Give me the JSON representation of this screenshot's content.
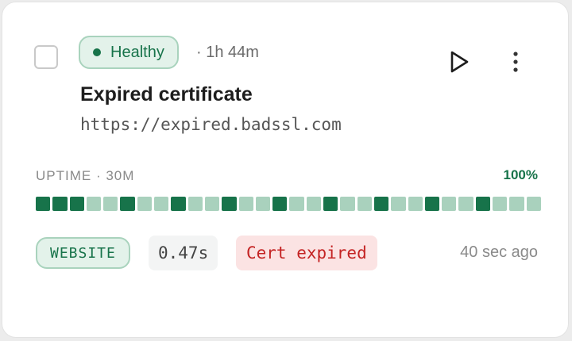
{
  "monitor": {
    "status_label": "Healthy",
    "status_color": "#17734a",
    "duration": "· 1h 44m",
    "title": "Expired certificate",
    "url": "https://expired.badssl.com"
  },
  "actions": {
    "play_icon": "play-icon",
    "more_icon": "more-vertical-icon"
  },
  "uptime": {
    "label": "UPTIME · 30M",
    "percent": "100%",
    "segments": [
      1,
      1,
      1,
      0,
      0,
      1,
      0,
      0,
      1,
      0,
      0,
      1,
      0,
      0,
      1,
      0,
      0,
      1,
      0,
      0,
      1,
      0,
      0,
      1,
      0,
      0,
      1,
      0,
      0,
      0
    ]
  },
  "tags": {
    "type": "WEBSITE",
    "response_time": "0.47s",
    "error": "Cert expired"
  },
  "last_checked": "40 sec ago",
  "colors": {
    "healthy_dark": "#17734a",
    "healthy_light": "#a9d1bd",
    "error_text": "#c42323",
    "error_bg": "#fbe3e3"
  }
}
